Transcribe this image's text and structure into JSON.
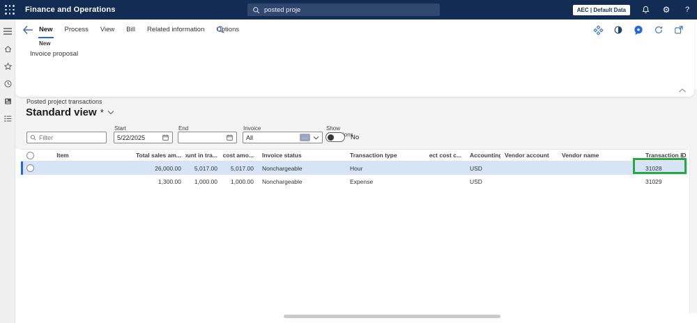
{
  "topbar": {
    "app_title": "Finance and Operations",
    "search_value": "posted proje",
    "environment_badge": "AEC | Default Data",
    "icons": [
      "notifications",
      "settings",
      "help"
    ]
  },
  "sidebar": {
    "items": [
      "menu",
      "home",
      "favorites",
      "recent",
      "workspaces",
      "modules"
    ]
  },
  "action_pane": {
    "tabs": [
      {
        "label": "New",
        "selected": true
      },
      {
        "label": "Process",
        "selected": false
      },
      {
        "label": "View",
        "selected": false
      },
      {
        "label": "Bill",
        "selected": false
      },
      {
        "label": "Related information",
        "selected": false
      },
      {
        "label": "Options",
        "selected": false
      }
    ],
    "group": {
      "label": "New",
      "items": [
        "Invoice proposal"
      ]
    },
    "right_icons": [
      "diamonds",
      "contrast",
      "messages",
      "refresh",
      "open-in-new-window"
    ]
  },
  "page": {
    "caption": "Posted project transactions",
    "view_name": "Standard view",
    "view_modified_marker": "*"
  },
  "filters": {
    "quick_filter": {
      "placeholder": "Filter",
      "value": ""
    },
    "start_date": {
      "label": "Start date",
      "value": "5/22/2025"
    },
    "end_date": {
      "label": "End date",
      "value": ""
    },
    "invoice_status": {
      "label": "Invoice status",
      "value": "All"
    },
    "show_deductions": {
      "label": "Show deductions",
      "state": "off",
      "state_text": "No"
    }
  },
  "grid": {
    "columns": [
      {
        "key": "item",
        "label": "Item"
      },
      {
        "key": "total_sales",
        "label": "Total sales am..."
      },
      {
        "key": "amount_in_trans",
        "label": "Amount in tra..."
      },
      {
        "key": "total_cost",
        "label": "Total cost amo..."
      },
      {
        "key": "invoice_status",
        "label": "Invoice status"
      },
      {
        "key": "transaction_type",
        "label": "Transaction type"
      },
      {
        "key": "indirect_cost",
        "label": "Indirect cost c..."
      },
      {
        "key": "accounting_currency",
        "label": "Accounting cu..."
      },
      {
        "key": "vendor_account",
        "label": "Vendor account"
      },
      {
        "key": "vendor_name",
        "label": "Vendor name"
      },
      {
        "key": "transaction_id",
        "label": "Transaction ID"
      }
    ],
    "rows": [
      {
        "selected": true,
        "item": "",
        "total_sales": "26,000.00",
        "amount_in_trans": "5,017.00",
        "total_cost": "5,017.00",
        "invoice_status": "Nonchargeable",
        "transaction_type": "Hour",
        "indirect_cost": "",
        "accounting_currency": "USD",
        "vendor_account": "",
        "vendor_name": "",
        "transaction_id": "31028",
        "highlighted_cell": "transaction_id"
      },
      {
        "selected": false,
        "item": "",
        "total_sales": "1,300.00",
        "amount_in_trans": "1,000.00",
        "total_cost": "1,000.00",
        "invoice_status": "Nonchargeable",
        "transaction_type": "Expense",
        "indirect_cost": "",
        "accounting_currency": "USD",
        "vendor_account": "",
        "vendor_name": "",
        "transaction_id": "31029"
      }
    ]
  },
  "colors": {
    "topbar_bg": "#122c54",
    "accent_blue": "#2266e3",
    "selected_row_bg": "#d7e4f8",
    "highlight_green": "#28a745",
    "sidebar_bg": "#f0f0f0"
  }
}
